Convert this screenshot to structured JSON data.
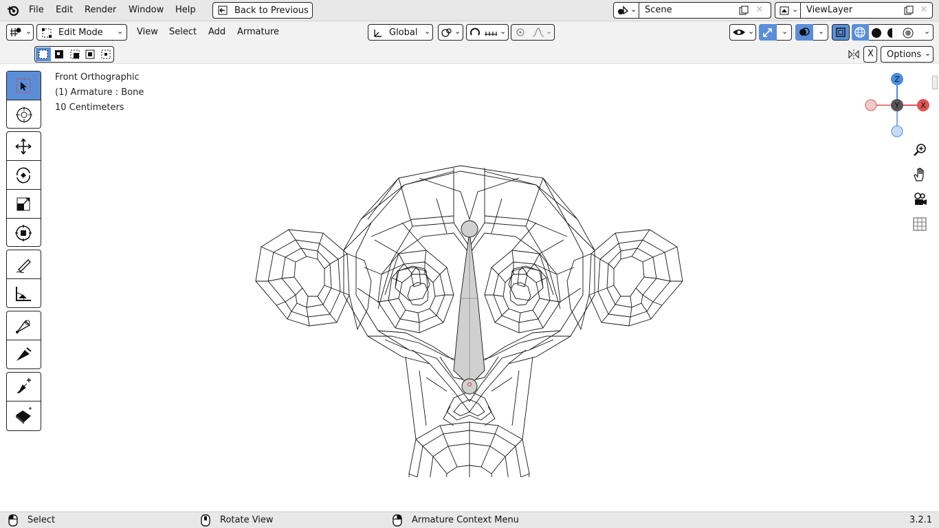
{
  "menubar": {
    "items": [
      "File",
      "Edit",
      "Render",
      "Window",
      "Help"
    ],
    "back_button": "Back to Previous",
    "scene_label": "Scene",
    "viewlayer_label": "ViewLayer"
  },
  "header": {
    "mode": "Edit Mode",
    "menus": [
      "View",
      "Select",
      "Add",
      "Armature"
    ],
    "transform_orientation": "Global",
    "options_label": "Options",
    "x_label": "X"
  },
  "viewport": {
    "view_name": "Front Orthographic",
    "object_info": "(1) Armature : Bone",
    "scale_info": "10 Centimeters",
    "gizmo": {
      "z": "Z",
      "y": "Y",
      "x": "X"
    }
  },
  "statusbar": {
    "left": "Select",
    "middle": "Rotate View",
    "right": "Armature Context Menu",
    "version": "3.2.1"
  },
  "colors": {
    "accent": "#5a8fd8",
    "axis_x": "#e05555",
    "axis_z": "#4a8ce0",
    "axis_y": "#555555"
  }
}
